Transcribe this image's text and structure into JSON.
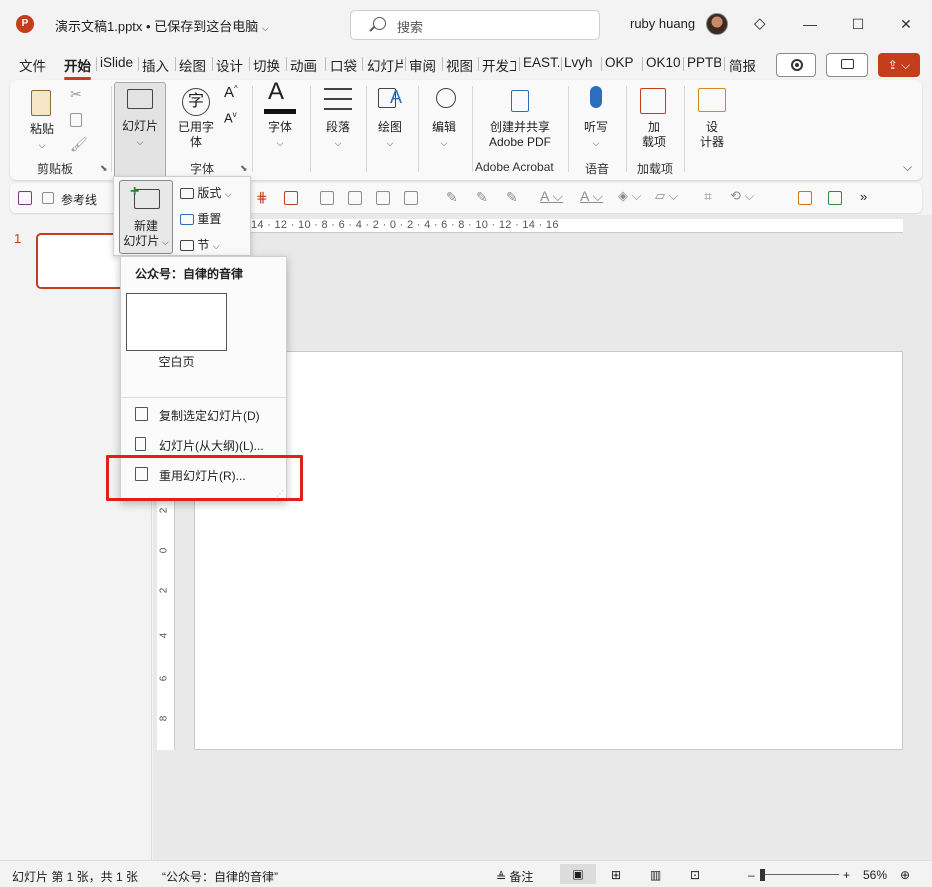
{
  "titlebar": {
    "app_icon": "P",
    "doc_title": "演示文稿1.pptx • 已保存到这台电脑",
    "search_placeholder": "搜索",
    "user_name": "ruby huang",
    "win_min": "—",
    "win_max": "☐",
    "win_close": "✕"
  },
  "tabs": [
    "文件",
    "开始",
    "iSlide",
    "插入",
    "绘图",
    "设计",
    "切换",
    "动画",
    "口袋",
    "幻灯片",
    "审阅",
    "视图",
    "开发工",
    "EAST.",
    "Lvyh",
    "OKP",
    "OK10",
    "PPTB.",
    "简报"
  ],
  "active_tab": "开始",
  "ribbon": {
    "paste": "粘贴",
    "clipboard_group": "剪贴板",
    "slides": "幻灯片",
    "used_font": "已用字",
    "used_font2": "体",
    "font_group": "字体",
    "font": "字体",
    "paragraph": "段落",
    "drawing": "绘图",
    "editing": "编辑",
    "create_share": "创建并共享",
    "adobe_pdf": "Adobe PDF",
    "adobe_group": "Adobe Acrobat",
    "dictate": "听写",
    "voice_group": "语音",
    "addin": "加",
    "addin2": "载项",
    "addin_group": "加载项",
    "designer": "设",
    "designer2": "计器"
  },
  "qat": {
    "guides_label": "参考线"
  },
  "slide_panel": {
    "layout": "版式",
    "reset": "重置",
    "section": "节",
    "new_slide_1": "新建",
    "new_slide_2": "幻灯片"
  },
  "ruler_text": "14 · 12 · 10 · 8 · 6 · 4 · 2 · 0 · 2 · 4 · 6 · 8 · 10 · 12 · 14 · 16",
  "vruler_ticks": [
    "2",
    "0",
    "2",
    "4",
    "6",
    "8"
  ],
  "thumbnail": {
    "number": "1"
  },
  "dropdown": {
    "header": "公众号：自律的音律",
    "blank_layout": "空白页",
    "items": [
      "复制选定幻灯片(D)",
      "幻灯片(从大纲)(L)...",
      "重用幻灯片(R)..."
    ]
  },
  "status": {
    "slide_count": "幻灯片 第 1 张，共 1 张",
    "theme": "“公众号：自律的音律”",
    "notes": "备注",
    "zoom_minus": "–",
    "zoom_plus": "+",
    "zoom": "56%"
  },
  "colors": {
    "accent": "#c43e1c",
    "highlight": "#e0201a"
  }
}
